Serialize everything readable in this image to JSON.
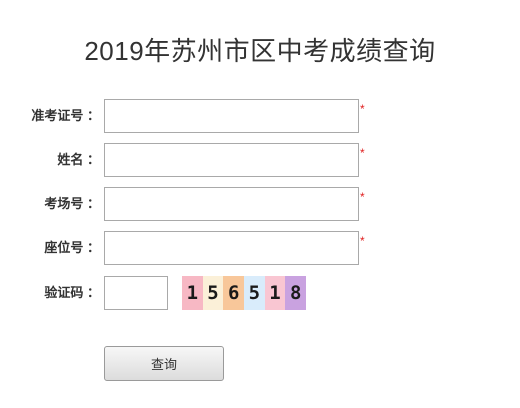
{
  "title": "2019年苏州市区中考成绩查询",
  "form": {
    "fields": [
      {
        "label": "准考证号 ：",
        "value": "",
        "required_mark": "*"
      },
      {
        "label": "姓名 ：",
        "value": "",
        "required_mark": "*"
      },
      {
        "label": "考场号 ：",
        "value": "",
        "required_mark": "*"
      },
      {
        "label": "座位号 ：",
        "value": "",
        "required_mark": "*"
      }
    ],
    "captcha": {
      "label": "验证码 ：",
      "value": "",
      "digits": [
        "1",
        "5",
        "6",
        "5",
        "1",
        "8"
      ],
      "cell_colors": [
        "#f7b8c4",
        "#fbf0d8",
        "#f8c79a",
        "#d9ecfb",
        "#f9c6d2",
        "#c9a2e0"
      ]
    },
    "submit_label": "查询"
  }
}
